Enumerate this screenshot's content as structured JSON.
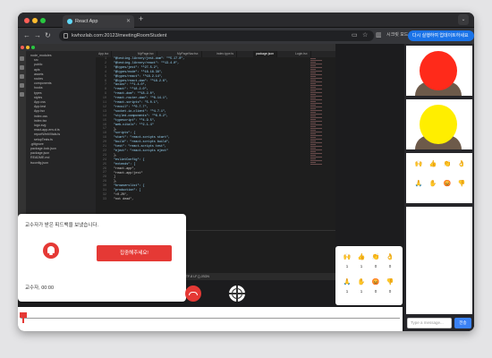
{
  "browser": {
    "tab_title": "React App",
    "url": "kwhozlab.com:20123/meetingRoomStudent",
    "guest_label": "시크릿 모드",
    "update_label": "다시 실행하여 업데이트하세요 :"
  },
  "editor": {
    "tabs": [
      "App.tsx",
      "MyPage.tsx",
      "MyPageNav.tsx",
      "index.type.ts",
      "package.json",
      "Login.tsx"
    ],
    "explorer": [
      "node_modules",
      "src",
      "public",
      "apis",
      "assets",
      "routes",
      "components",
      "hooks",
      "types",
      "styles",
      "App.css",
      "App.test",
      "App.tsx",
      "index.css",
      "index.tsx",
      "logo.svg",
      "react-app-env.d.ts",
      "reportWebVitals.ts",
      "setupTests.ts",
      ".gitignore",
      "package-lock.json",
      "package.json",
      "README.md",
      "tsconfig.json"
    ],
    "lines": [
      "\"@testing-library/jest-dom\": \"^5.17.0\",",
      "\"@testing-library/react\": \"^13.4.0\",",
      "\"@types/jest\": \"^27.5.2\",",
      "\"@types/node\": \"^16.18.38\",",
      "\"@types/react\": \"^18.2.14\",",
      "\"@types/react-dom\": \"^18.2.6\",",
      "\"axios\": \"^1.4.0\",",
      "\"react\": \"^18.2.0\",",
      "\"react-dom\": \"^18.2.0\",",
      "\"react-router-dom\": \"^6.14.1\",",
      "\"react-scripts\": \"5.0.1\",",
      "\"recoil\": \"^0.7.7\",",
      "\"socket.io-client\": \"^4.7.1\",",
      "\"styled-components\": \"^6.0.2\",",
      "\"typescript\": \"^4.9.5\",",
      "\"web-vitals\": \"^2.1.4\"",
      "},",
      "\"scripts\": {",
      "\"start\": \"react-scripts start\",",
      "\"build\": \"react-scripts build\",",
      "\"test\": \"react-scripts test\",",
      "\"eject\": \"react-scripts eject\"",
      "},",
      "\"eslintConfig\": {",
      "\"extends\": [",
      "\"react-app\",",
      "\"react-app/jest\"",
      "]",
      "},",
      "\"browserslist\": {",
      "\"production\": [",
      "\">0.2%\",",
      "\"not dead\","
    ],
    "status_text": "Ln 26, Col 12   Spaces: 2   UTF-8   LF   {} JSON"
  },
  "feedback": {
    "title": "교수자가 받은 피드백을 보냈습니다.",
    "button": "집중해주세요!",
    "time": "교수자, 00:00"
  },
  "reactions": {
    "row1": [
      {
        "emoji": "🙌",
        "count": "1"
      },
      {
        "emoji": "👍",
        "count": "1"
      },
      {
        "emoji": "👏",
        "count": "0"
      },
      {
        "emoji": "👌",
        "count": "0"
      }
    ],
    "row2": [
      {
        "emoji": "🙏",
        "count": "1"
      },
      {
        "emoji": "✋",
        "count": "1"
      },
      {
        "emoji": "😡",
        "count": "0"
      },
      {
        "emoji": "👎",
        "count": "0"
      }
    ]
  },
  "side_reactions": {
    "row1": [
      "🙌",
      "👍",
      "👏",
      "👌"
    ],
    "row2": [
      "🙏",
      "✋",
      "😡",
      "👎"
    ]
  },
  "participants": [
    {
      "face_color": "#ff2a1a"
    },
    {
      "face_color": "#ffee00"
    }
  ],
  "chat": {
    "placeholder": "Type a message...",
    "send_label": "전송"
  }
}
